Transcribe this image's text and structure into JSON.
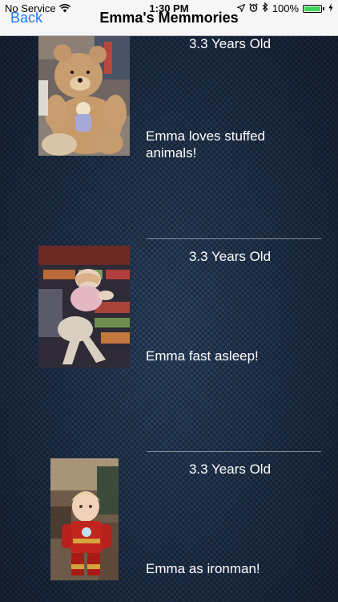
{
  "status_bar": {
    "carrier": "No Service",
    "time": "1:30 PM",
    "battery": "100%",
    "battery_level": 1.0,
    "icons": [
      "wifi-icon",
      "location-arrow-icon",
      "alarm-clock-icon",
      "bluetooth-icon",
      "battery-icon",
      "charging-bolt-icon"
    ]
  },
  "nav": {
    "back_label": "Back",
    "title": "Emma's Memmories"
  },
  "memories": [
    {
      "age": "3.3 Years Old",
      "caption": "Emma loves stuffed animals!",
      "photo": "teddy-bear-photo"
    },
    {
      "age": "3.3 Years Old",
      "caption": "Emma fast asleep!",
      "photo": "sleeping-photo"
    },
    {
      "age": "3.3 Years Old",
      "caption": "Emma as ironman!",
      "photo": "ironman-photo"
    }
  ],
  "colors": {
    "accent": "#1f7cf6",
    "background": "#1e2d44",
    "text": "#ffffff"
  }
}
